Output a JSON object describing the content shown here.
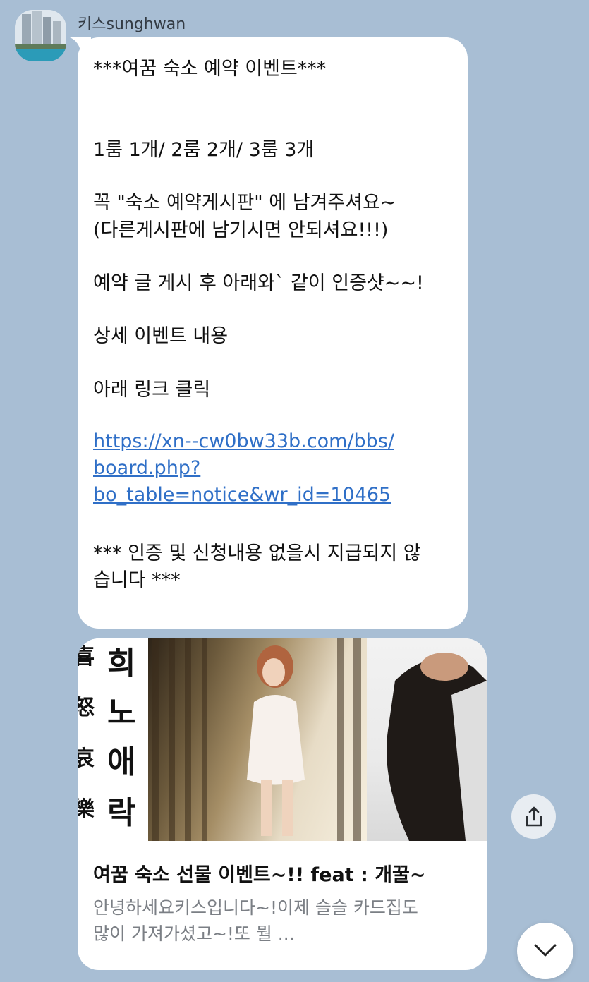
{
  "sender": {
    "name": "키스sunghwan"
  },
  "message": {
    "lines": [
      "***여꿈 숙소 예약 이벤트***",
      "1룸 1개/ 2룸 2개/ 3룸 3개",
      "꼭  \"숙소 예약게시판\" 에 남겨주셔요~",
      "(다른게시판에 남기시면 안되셔요!!!)",
      "예약 글 게시 후 아래와` 같이 인증샷~~!",
      "상세 이벤트 내용",
      "아래 링크 클릭",
      "*** 인증 및 신청내용 없을시 지급되지 않",
      "습니다 ***"
    ],
    "link_lines": [
      "https://xn--cw0bw33b.com/bbs/",
      "board.php?",
      "bo_table=notice&wr_id=10465"
    ]
  },
  "preview_card": {
    "image_text": {
      "col1": [
        "희",
        "노",
        "애",
        "락"
      ],
      "col0": [
        "喜",
        "怒",
        "哀",
        "樂"
      ]
    },
    "title": "여꿈 숙소 선물 이벤트~!! feat : 개꿀~",
    "desc_line1": "안녕하세요키스입니다~!이제 슬슬 카드집도",
    "desc_line2": "많이 가져가셨고~!또 뭘 ..."
  },
  "icons": {
    "share": "share-icon",
    "scroll": "chevron-down-icon"
  },
  "colors": {
    "background": "#a8bed4",
    "bubble": "#ffffff",
    "link": "#2f6fc7",
    "desc": "#7b7f85"
  }
}
